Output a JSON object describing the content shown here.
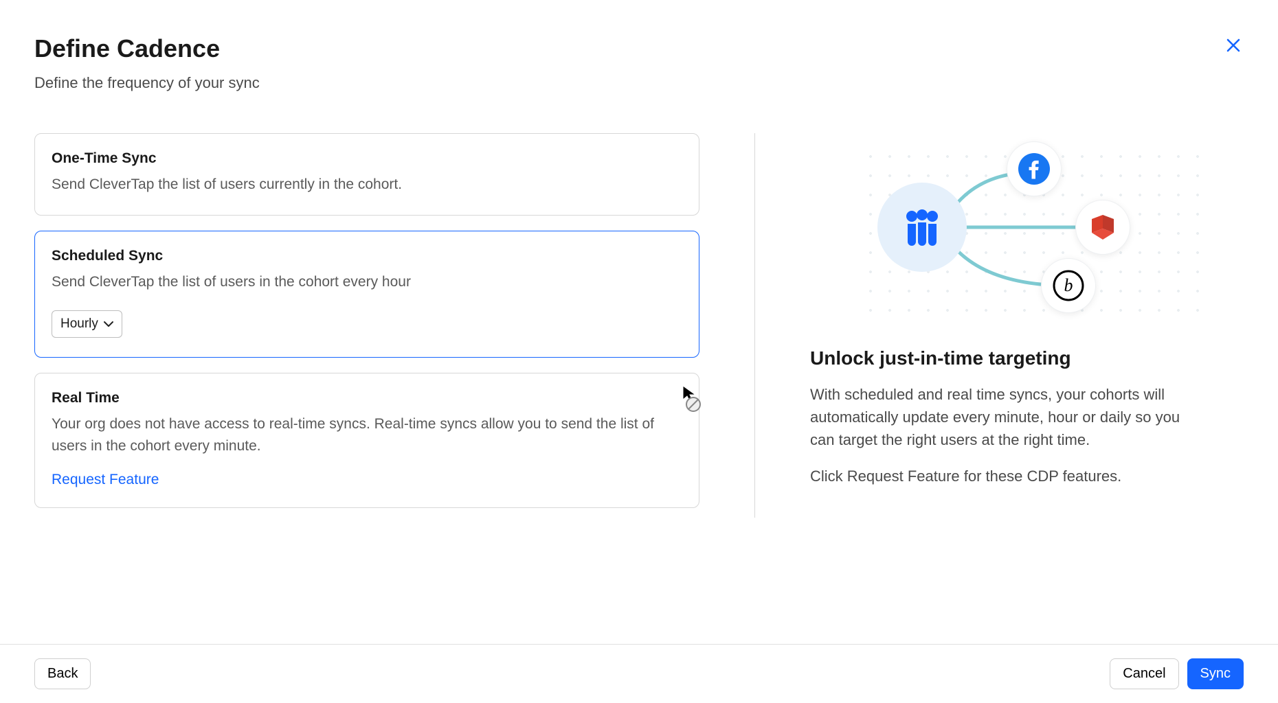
{
  "header": {
    "title": "Define Cadence",
    "subtitle": "Define the frequency of your sync"
  },
  "options": {
    "one_time": {
      "title": "One-Time Sync",
      "desc": "Send CleverTap the list of users currently in the cohort."
    },
    "scheduled": {
      "title": "Scheduled Sync",
      "desc": "Send CleverTap the list of users in the cohort every hour",
      "frequency_label": "Hourly"
    },
    "realtime": {
      "title": "Real Time",
      "desc": "Your org does not have access to real-time syncs. Real-time syncs allow you to send the list of users in the cohort every minute.",
      "request_label": "Request Feature"
    }
  },
  "sidebar": {
    "title": "Unlock just-in-time targeting",
    "p1": "With scheduled and real time syncs, your cohorts will automatically update every minute, hour or daily so you can target the right users at the right time.",
    "p2": "Click Request Feature for these CDP features."
  },
  "footer": {
    "back": "Back",
    "cancel": "Cancel",
    "sync": "Sync"
  },
  "icons": {
    "close": "close-icon",
    "chevron_down": "chevron-down-icon",
    "people": "people-icon",
    "facebook": "facebook-icon",
    "aws": "aws-icon",
    "b_logo": "circle-b-logo-icon",
    "cursor": "cursor-not-allowed-icon"
  },
  "colors": {
    "accent": "#1565ff",
    "text_muted": "#5a5a5a",
    "border": "#d7d7d7"
  }
}
